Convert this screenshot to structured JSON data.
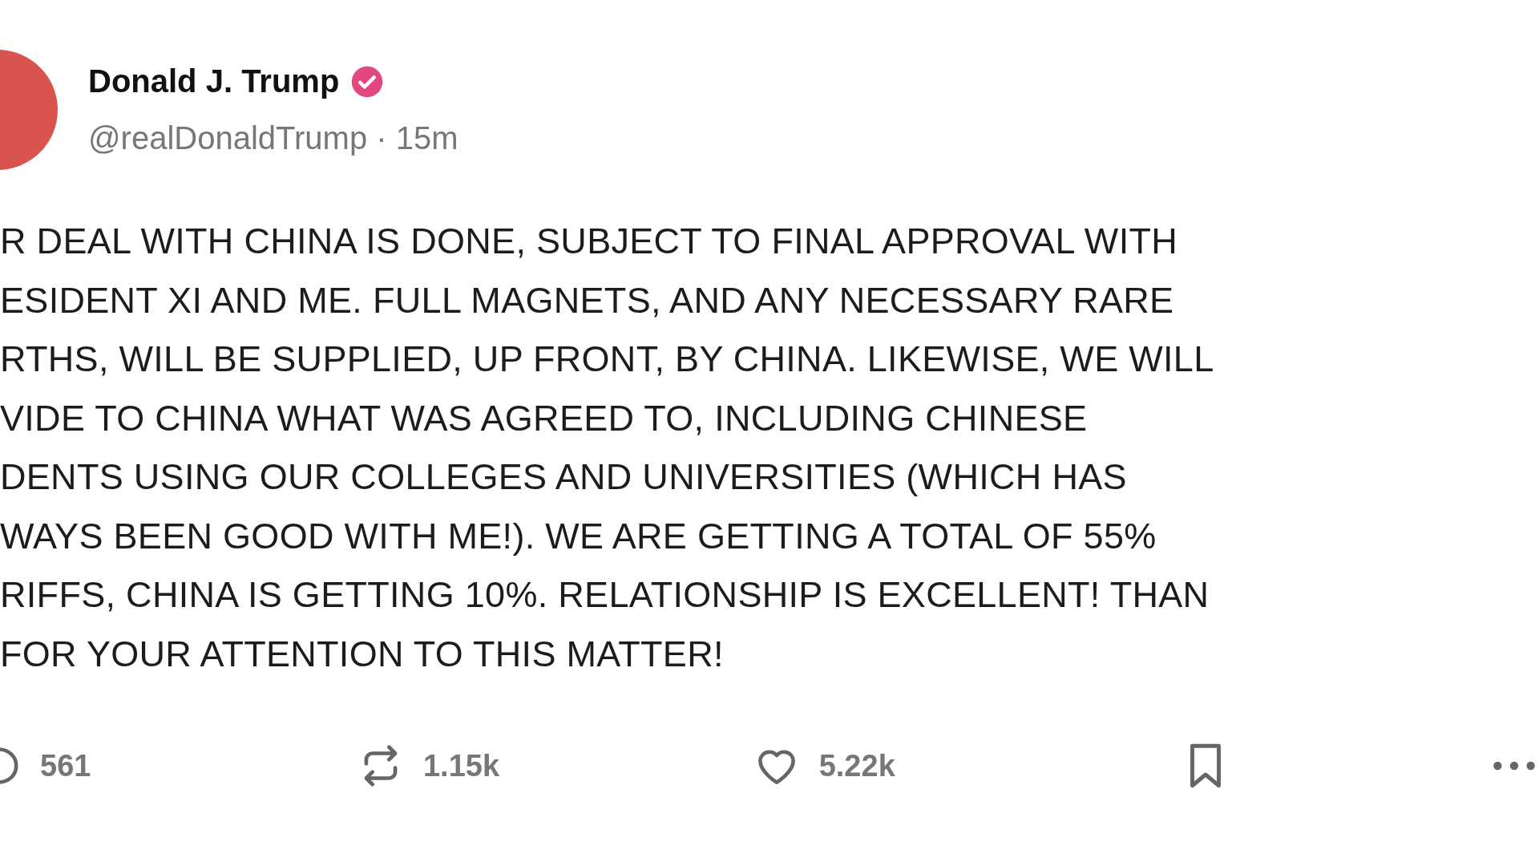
{
  "author": {
    "name": "Donald J. Trump",
    "verified": true,
    "meta": "@realDonaldTrump · 15m"
  },
  "body_lines": [
    "R DEAL WITH CHINA IS DONE, SUBJECT TO FINAL APPROVAL WITH",
    "ESIDENT XI AND ME. FULL MAGNETS, AND ANY NECESSARY RARE",
    "RTHS, WILL BE SUPPLIED, UP FRONT, BY CHINA. LIKEWISE, WE WILL",
    "VIDE TO CHINA WHAT WAS AGREED TO, INCLUDING CHINESE",
    "DENTS USING OUR COLLEGES AND UNIVERSITIES (WHICH HAS",
    "WAYS BEEN GOOD WITH ME!). WE ARE GETTING A TOTAL OF 55%",
    "RIFFS, CHINA IS GETTING 10%. RELATIONSHIP IS EXCELLENT! THAN",
    "FOR YOUR ATTENTION TO THIS MATTER!"
  ],
  "actions": [
    {
      "kind": "reply",
      "count": "561"
    },
    {
      "kind": "repost",
      "count": "1.15k"
    },
    {
      "kind": "like",
      "count": "5.22k"
    },
    {
      "kind": "bookmark"
    },
    {
      "kind": "more"
    }
  ]
}
